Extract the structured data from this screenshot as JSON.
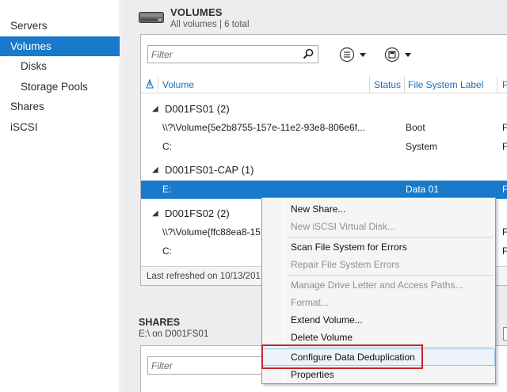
{
  "sidebar": {
    "items": [
      {
        "label": "Servers"
      },
      {
        "label": "Volumes"
      },
      {
        "label": "Disks"
      },
      {
        "label": "Storage Pools"
      },
      {
        "label": "Shares"
      },
      {
        "label": "iSCSI"
      }
    ]
  },
  "volumes": {
    "title": "VOLUMES",
    "subtitle": "All volumes | 6 total",
    "filter_placeholder": "Filter",
    "columns": {
      "volume": "Volume",
      "status": "Status",
      "fs_label": "File System Label",
      "extra": "P"
    },
    "groups": [
      {
        "label": "D001FS01 (2)",
        "rows": [
          {
            "volume": "\\\\?\\Volume{5e2b8755-157e-11e2-93e8-806e6f...",
            "fs_label": "Boot",
            "extra": "F"
          },
          {
            "volume": "C:",
            "fs_label": "System",
            "extra": "F"
          }
        ]
      },
      {
        "label": "D001FS01-CAP (1)",
        "rows": [
          {
            "volume": "E:",
            "fs_label": "Data 01",
            "extra": "F"
          }
        ]
      },
      {
        "label": "D001FS02 (2)",
        "rows": [
          {
            "volume": "\\\\?\\Volume{ffc88ea8-15",
            "fs_label": "",
            "extra": "F"
          },
          {
            "volume": "C:",
            "fs_label": "",
            "extra": "F"
          }
        ]
      }
    ],
    "footer": "Last refreshed on 10/13/201"
  },
  "shares": {
    "title": "SHARES",
    "subtitle": "E:\\ on D001FS01",
    "filter_placeholder": "Filter"
  },
  "context_menu": {
    "items": [
      {
        "label": "New Share...",
        "enabled": true
      },
      {
        "label": "New iSCSI Virtual Disk...",
        "enabled": false
      },
      {
        "label": "Scan File System for Errors",
        "enabled": true
      },
      {
        "label": "Repair File System Errors",
        "enabled": false
      },
      {
        "label": "Manage Drive Letter and Access Paths...",
        "enabled": false
      },
      {
        "label": "Format...",
        "enabled": false
      },
      {
        "label": "Extend Volume...",
        "enabled": true
      },
      {
        "label": "Delete Volume",
        "enabled": true
      },
      {
        "label": "Configure Data Deduplication",
        "enabled": true,
        "highlighted": true
      },
      {
        "label": "Properties",
        "enabled": true
      }
    ]
  },
  "colors": {
    "selection": "#1979ca",
    "header_text": "#1d6fb8",
    "highlight_box": "#c4242a",
    "background": "#ecedef"
  },
  "icons": {
    "volumes_header": "drive-icon",
    "filter": "search-icon",
    "view": "list-view-icon",
    "save": "save-icon",
    "sort": "sort-arrow-icon",
    "expand": "expand-triangle-icon"
  }
}
